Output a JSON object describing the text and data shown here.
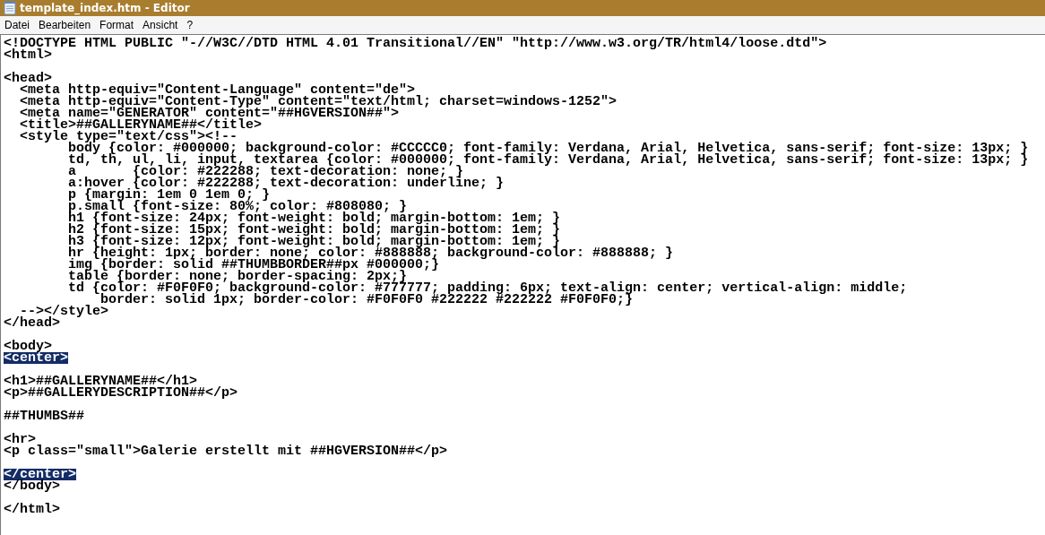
{
  "window": {
    "title": "template_index.htm - Editor"
  },
  "menu": [
    "Datei",
    "Bearbeiten",
    "Format",
    "Ansicht",
    "?"
  ],
  "lines": [
    {
      "kind": "code",
      "text": "<!DOCTYPE HTML PUBLIC \"-//W3C//DTD HTML 4.01 Transitional//EN\" \"http://www.w3.org/TR/html4/loose.dtd\">",
      "selected": false
    },
    {
      "kind": "code",
      "text": "<html>",
      "selected": false
    },
    {
      "kind": "blank",
      "selected": false
    },
    {
      "kind": "code",
      "text": "<head>",
      "selected": false
    },
    {
      "kind": "code",
      "text": "  <meta http-equiv=\"Content-Language\" content=\"de\">",
      "selected": false
    },
    {
      "kind": "code",
      "text": "  <meta http-equiv=\"Content-Type\" content=\"text/html; charset=windows-1252\">",
      "selected": false
    },
    {
      "kind": "code",
      "text": "  <meta name=\"GENERATOR\" content=\"##HGVERSION##\">",
      "selected": false
    },
    {
      "kind": "code",
      "text": "  <title>##GALLERYNAME##</title>",
      "selected": false
    },
    {
      "kind": "code",
      "text": "  <style type=\"text/css\"><!--",
      "selected": false
    },
    {
      "kind": "code",
      "text": "\tbody {color: #000000; background-color: #CCCCC0; font-family: Verdana, Arial, Helvetica, sans-serif; font-size: 13px; }",
      "selected": false
    },
    {
      "kind": "code",
      "text": "\ttd, th, ul, li, input, textarea {color: #000000; font-family: Verdana, Arial, Helvetica, sans-serif; font-size: 13px; }",
      "selected": false
    },
    {
      "kind": "code",
      "text": "\ta\t{color: #222288; text-decoration: none; }",
      "selected": false
    },
    {
      "kind": "code",
      "text": "\ta:hover {color: #222288; text-decoration: underline; }",
      "selected": false
    },
    {
      "kind": "code",
      "text": "\tp {margin: 1em 0 1em 0; }",
      "selected": false
    },
    {
      "kind": "code",
      "text": "\tp.small {font-size: 80%; color: #808080; }",
      "selected": false
    },
    {
      "kind": "code",
      "text": "\th1 {font-size: 24px; font-weight: bold; margin-bottom: 1em; }",
      "selected": false
    },
    {
      "kind": "code",
      "text": "\th2 {font-size: 15px; font-weight: bold; margin-bottom: 1em; }",
      "selected": false
    },
    {
      "kind": "code",
      "text": "\th3 {font-size: 12px; font-weight: bold; margin-bottom: 1em; }",
      "selected": false
    },
    {
      "kind": "code",
      "text": "\thr {height: 1px; border: none; color: #888888; background-color: #888888; }",
      "selected": false
    },
    {
      "kind": "code",
      "text": "\timg {border: solid ##THUMBBORDER##px #000000;}",
      "selected": false
    },
    {
      "kind": "code",
      "text": "\ttable {border: none; border-spacing: 2px;}",
      "selected": false
    },
    {
      "kind": "code",
      "text": "\ttd {color: #F0F0F0; background-color: #777777; padding: 6px; text-align: center; vertical-align: middle;",
      "selected": false
    },
    {
      "kind": "code",
      "text": "\t    border: solid 1px; border-color: #F0F0F0 #222222 #222222 #F0F0F0;}",
      "selected": false
    },
    {
      "kind": "code",
      "text": "  --></style>",
      "selected": false
    },
    {
      "kind": "code",
      "text": "</head>",
      "selected": false
    },
    {
      "kind": "blank",
      "selected": false
    },
    {
      "kind": "code",
      "text": "<body>",
      "selected": false
    },
    {
      "kind": "code",
      "text": "<center>",
      "selected": true
    },
    {
      "kind": "blank",
      "selected": false
    },
    {
      "kind": "code",
      "text": "<h1>##GALLERYNAME##</h1>",
      "selected": false
    },
    {
      "kind": "code",
      "text": "<p>##GALLERYDESCRIPTION##</p>",
      "selected": false
    },
    {
      "kind": "blank",
      "selected": false
    },
    {
      "kind": "code",
      "text": "##THUMBS##",
      "selected": false
    },
    {
      "kind": "blank",
      "selected": false
    },
    {
      "kind": "code",
      "text": "<hr>",
      "selected": false
    },
    {
      "kind": "code",
      "text": "<p class=\"small\">Galerie erstellt mit ##HGVERSION##</p>",
      "selected": false
    },
    {
      "kind": "blank",
      "selected": false
    },
    {
      "kind": "code",
      "text": "</center>",
      "selected": true
    },
    {
      "kind": "code",
      "text": "</body>",
      "selected": false
    },
    {
      "kind": "blank",
      "selected": false
    },
    {
      "kind": "code",
      "text": "</html>",
      "selected": false
    }
  ]
}
